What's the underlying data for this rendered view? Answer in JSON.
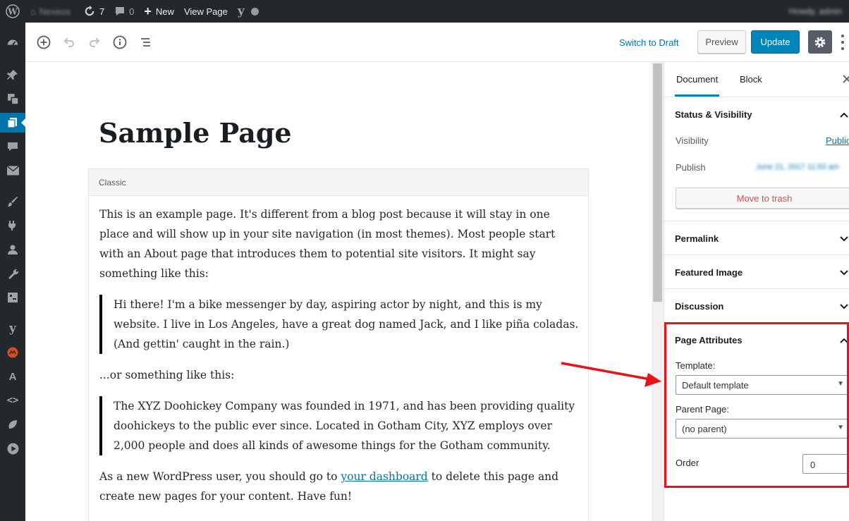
{
  "adminbar": {
    "site_name": "Nexeos",
    "updates_count": "7",
    "comments_count": "0",
    "new_label": "New",
    "view_page_label": "View Page",
    "howdy": "Howdy, admin"
  },
  "toolbar": {
    "switch_draft": "Switch to Draft",
    "preview": "Preview",
    "update": "Update"
  },
  "editor": {
    "title": "Sample Page",
    "classic_label": "Classic",
    "paragraph1": "This is an example page. It's different from a blog post because it will stay in one place and will show up in your site navigation (in most themes). Most people start with an About page that introduces them to potential site visitors. It might say something like this:",
    "quote1": "Hi there! I'm a bike messenger by day, aspiring actor by night, and this is my website. I live in Los Angeles, have a great dog named Jack, and I like piña coladas. (And gettin' caught in the rain.)",
    "paragraph2": "...or something like this:",
    "quote2": "The XYZ Doohickey Company was founded in 1971, and has been providing quality doohickeys to the public ever since. Located in Gotham City, XYZ employs over 2,000 people and does all kinds of awesome things for the Gotham community.",
    "paragraph3_before": "As a new WordPress user, you should go to ",
    "paragraph3_link": "your dashboard",
    "paragraph3_after": " to delete this page and create new pages for your content. Have fun!"
  },
  "sidebar": {
    "tab_document": "Document",
    "tab_block": "Block",
    "status_visibility": "Status & Visibility",
    "visibility_label": "Visibility",
    "visibility_value": "Public",
    "publish_label": "Publish",
    "publish_value": "June 21, 2017 11:53 am",
    "move_to_trash": "Move to trash",
    "permalink": "Permalink",
    "featured_image": "Featured Image",
    "discussion": "Discussion",
    "page_attributes": "Page Attributes",
    "template_label": "Template:",
    "template_value": "Default template",
    "parent_label": "Parent Page:",
    "parent_value": "(no parent)",
    "order_label": "Order",
    "order_value": "0"
  },
  "colors": {
    "accent": "#0085ba",
    "highlight": "#e8121b",
    "adminbar": "#23282d"
  }
}
